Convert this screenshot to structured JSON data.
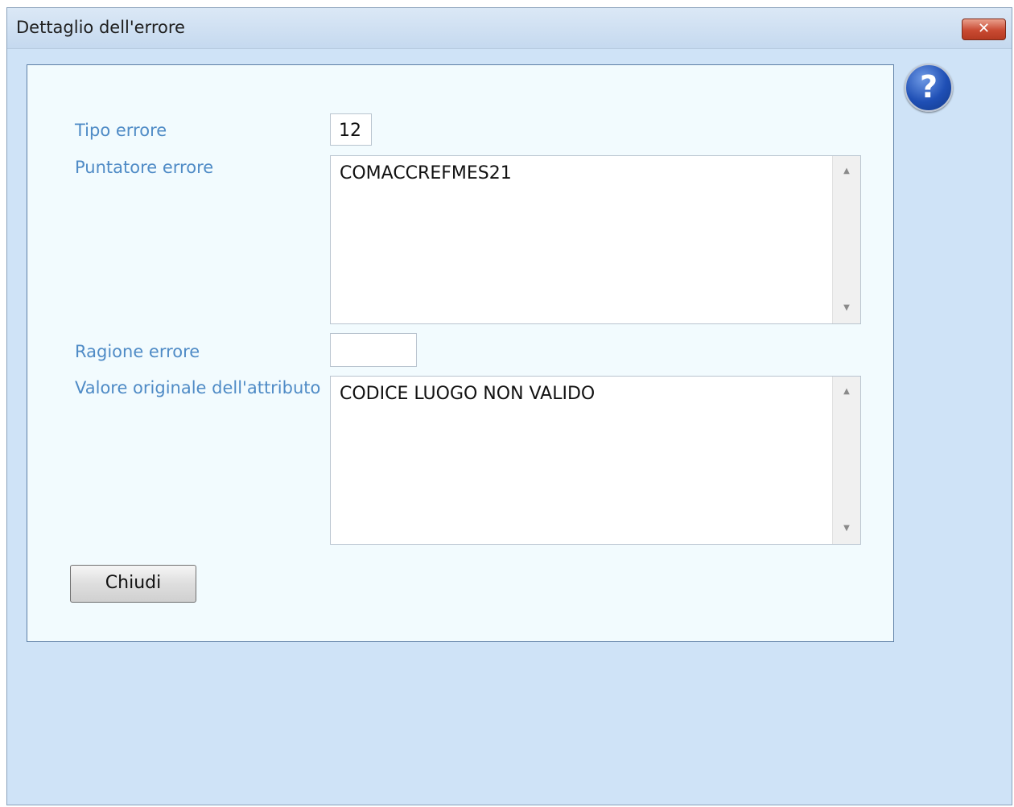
{
  "window": {
    "title": "Dettaglio dell'errore",
    "close_glyph": "✕"
  },
  "help": {
    "glyph": "?"
  },
  "form": {
    "tipo_errore": {
      "label": "Tipo errore",
      "value": "12"
    },
    "puntatore_errore": {
      "label": "Puntatore errore",
      "value": "COMACCREFMES21"
    },
    "ragione_errore": {
      "label": "Ragione errore",
      "value": ""
    },
    "valore_originale": {
      "label": "Valore originale dell'attributo",
      "value": "CODICE LUOGO NON VALIDO"
    }
  },
  "buttons": {
    "close_label": "Chiudi"
  },
  "icons": {
    "help": "question-circle-icon",
    "close": "close-icon",
    "scroll_up": "chevron-up-icon",
    "scroll_down": "chevron-down-icon"
  },
  "colors": {
    "label": "#4f8bc6",
    "panel_bg": "#f2fbfe",
    "window_bg": "#cfe3f7",
    "close_button": "#c94a32",
    "help_icon": "#1f4fb5"
  }
}
